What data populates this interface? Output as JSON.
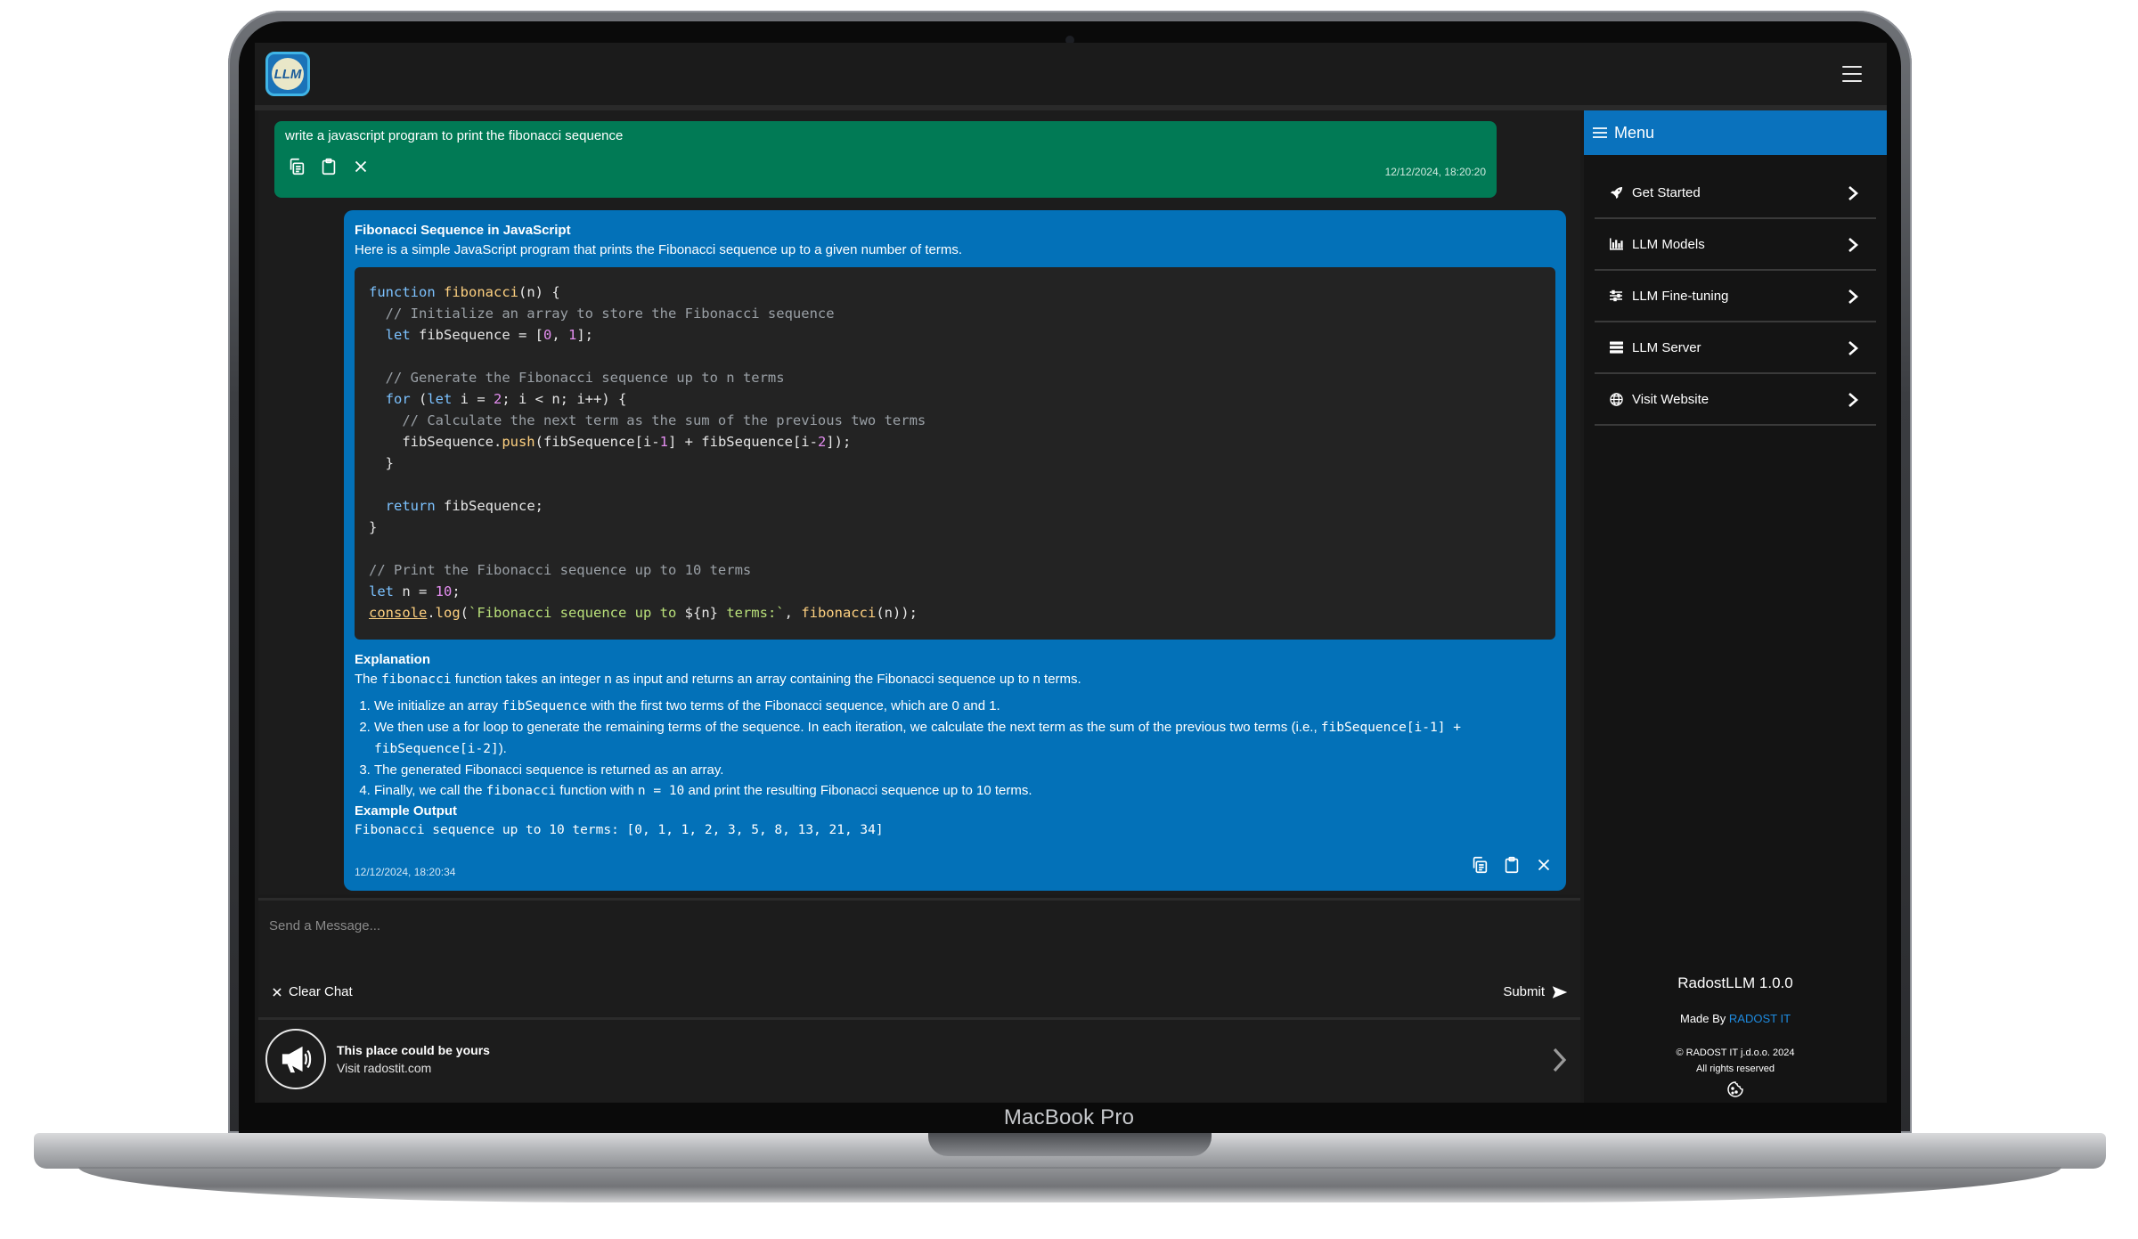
{
  "device": {
    "label": "MacBook Pro"
  },
  "app": {
    "logo_text": "LLM"
  },
  "chat": {
    "user_message": {
      "text": "write a javascript program to print the fibonacci sequence",
      "timestamp": "12/12/2024, 18:20:20"
    },
    "bot_message": {
      "title": "Fibonacci Sequence in JavaScript",
      "intro": "Here is a simple JavaScript program that prints the Fibonacci sequence up to a given number of terms.",
      "explanation_heading": "Explanation",
      "explanation_pre": "The ",
      "explanation_code": "fibonacci",
      "explanation_post": " function takes an integer n as input and returns an array containing the Fibonacci sequence up to n terms.",
      "list": [
        {
          "pre": "We initialize an array ",
          "code": "fibSequence",
          "post": " with the first two terms of the Fibonacci sequence, which are 0 and 1."
        },
        {
          "pre": "We then use a for loop to generate the remaining terms of the sequence. In each iteration, we calculate the next term as the sum of the previous two terms (i.e., ",
          "code": "fibSequence[i-1] + fibSequence[i-2]",
          "post": ")."
        },
        {
          "pre": "The generated Fibonacci sequence is returned as an array.",
          "code": "",
          "post": ""
        },
        {
          "pre": "Finally, we call the ",
          "code": "fibonacci",
          "post": " function with ",
          "code2": "n = 10",
          "post2": " and print the resulting Fibonacci sequence up to 10 terms."
        }
      ],
      "output_heading": "Example Output",
      "output_text": "Fibonacci sequence up to 10 terms: [0, 1, 1, 2, 3, 5, 8, 13, 21, 34]",
      "timestamp": "12/12/2024, 18:20:34"
    }
  },
  "input": {
    "placeholder": "Send a Message...",
    "clear_label": "Clear Chat",
    "submit_label": "Submit"
  },
  "ad": {
    "title": "This place could be yours",
    "subtitle": "Visit radostit.com"
  },
  "sidebar": {
    "menu_title": "Menu",
    "items": [
      {
        "label": "Get Started",
        "icon": "rocket-icon"
      },
      {
        "label": "LLM Models",
        "icon": "chart-icon"
      },
      {
        "label": "LLM Fine-tuning",
        "icon": "sliders-icon"
      },
      {
        "label": "LLM Server",
        "icon": "server-icon"
      },
      {
        "label": "Visit Website",
        "icon": "globe-icon"
      }
    ],
    "version": "RadostLLM 1.0.0",
    "made_by_prefix": "Made By ",
    "made_by_link": "RADOST IT",
    "copyright": "© RADOST IT j.d.o.o. 2024",
    "rights": "All rights reserved"
  },
  "colors": {
    "user_bubble": "#017a55",
    "bot_bubble": "#0371b8",
    "menu_header": "#0a72bd",
    "link": "#1e8be0"
  }
}
